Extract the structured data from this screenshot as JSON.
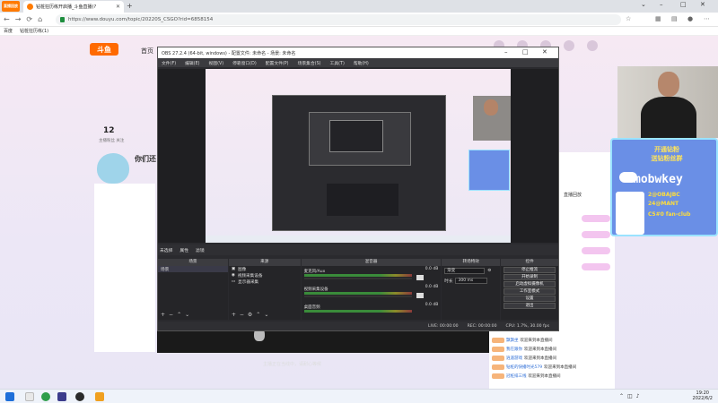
{
  "browser": {
    "corner_logo": "直播回放",
    "tab_title": "钻桩狂历练开启播_斗鱼直播(?",
    "url": "https://www.douyu.com/topic/20220S_CSGO?rid=6858154",
    "bookmarks": [
      "百度",
      "钻桩狂历练(1)"
    ]
  },
  "douyu": {
    "logo": "斗鱼",
    "nav_home": "首页",
    "follower_count": "12",
    "follower_label": "主播粉丝 关注",
    "streamer_tagline": "你们还",
    "player_message": "主播正在当线中，请耐心等候",
    "right_title": "直播回放",
    "chat": [
      {
        "name": "飘飘坐",
        "msg": "欢迎来到本直播间"
      },
      {
        "name": "我在跟你",
        "msg": "欢迎来到本直播间"
      },
      {
        "name": "逍遥游戏",
        "msg": "欢迎来到本直播间"
      },
      {
        "name": "钻桩的快播时光579",
        "msg": "欢迎来到本直播间"
      },
      {
        "name": "冠桩排三线",
        "msg": "欢迎来到本直播间"
      }
    ]
  },
  "banner": {
    "title_line1": "开通钻粉",
    "title_line2": "送钻粉丝群",
    "handle": "mobwkey",
    "line1": "2@OBAJBC",
    "line2": "24@MANT",
    "line3": "C5#0 fan-club"
  },
  "obs": {
    "title": "OBS 27.2.4 (64-bit, windows) - 配置文件: 未命名 - 场景: 未命名",
    "menu": [
      "文件(F)",
      "编辑(E)",
      "视图(V)",
      "停靠窗口(D)",
      "配置文件(P)",
      "场景集合(S)",
      "工具(T)",
      "帮助(H)"
    ],
    "tabs": [
      "未选择",
      "属性",
      "滤镜"
    ],
    "docks": {
      "scenes": "场景",
      "sources": "来源",
      "mixer": "混音器",
      "transitions": "转场特效",
      "controls": "控件"
    },
    "scene_items": [
      "场景"
    ],
    "source_items": [
      "图像",
      "视频采集设备",
      "显示器采集"
    ],
    "mixer_items": [
      {
        "name": "麦克风/Aux",
        "db": "0.0 dB"
      },
      {
        "name": "视频采集设备",
        "db": "0.0 dB"
      },
      {
        "name": "桌面音频",
        "db": "0.0 dB"
      }
    ],
    "transition": {
      "type": "渐变",
      "duration_label": "时长",
      "duration": "300 ms"
    },
    "controls": [
      "停止推流",
      "开始录制",
      "启动虚拟摄像机",
      "工作室模式",
      "设置",
      "退出"
    ],
    "status": {
      "live": "LIVE: 00:00:00",
      "rec": "REC: 00:00:00",
      "cpu": "CPU: 1.7%, 30.00 fps"
    }
  },
  "taskbar": {
    "time": "19:20",
    "date": "2022/6/2"
  }
}
